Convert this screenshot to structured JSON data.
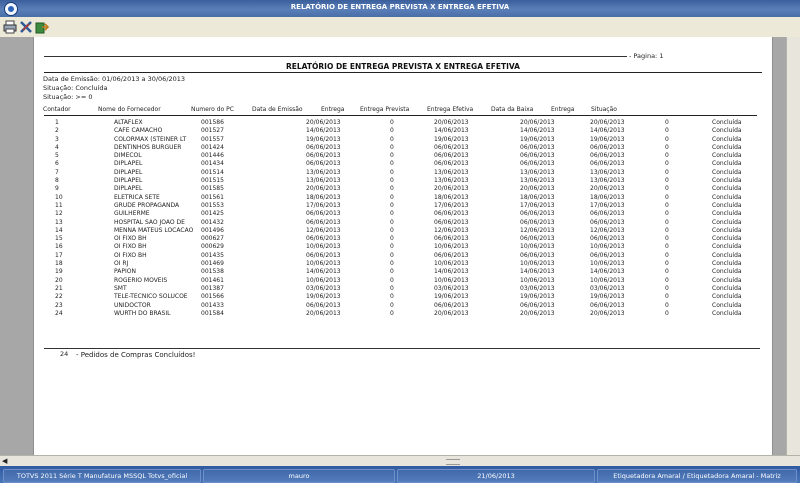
{
  "window": {
    "title": "RELATÓRIO DE ENTREGA PREVISTA X ENTREGA EFETIVA"
  },
  "toolbar": {
    "icons": [
      "print-icon",
      "close-icon",
      "export-icon"
    ]
  },
  "report": {
    "pagina": "- Pagina: 1",
    "title": "RELATÓRIO DE ENTREGA PREVISTA X ENTREGA EFETIVA",
    "emissao": "Data de Emissão: 01/06/2013 a 30/06/2013",
    "situacao": "Situação: Concluída",
    "situacao2": "Situação: >= 0",
    "columns": [
      "Contador",
      "Nome do Fornecedor",
      "Numero do PC",
      "Data de Emissão",
      "Entrega",
      "Entrega Prevista",
      "Entrega Efetiva",
      "Data da Baixa",
      "Entrega",
      "Situação"
    ],
    "rows": [
      [
        "1",
        "ALTAFLEX",
        "001586",
        "20/06/2013",
        "0",
        "20/06/2013",
        "20/06/2013",
        "20/06/2013",
        "0",
        "Concluída"
      ],
      [
        "2",
        "CAFE CAMACHO",
        "001527",
        "14/06/2013",
        "0",
        "14/06/2013",
        "14/06/2013",
        "14/06/2013",
        "0",
        "Concluída"
      ],
      [
        "3",
        "COLORMAX (STEINER LT",
        "001557",
        "19/06/2013",
        "0",
        "19/06/2013",
        "19/06/2013",
        "19/06/2013",
        "0",
        "Concluída"
      ],
      [
        "4",
        "DENTINHOS BURGUER",
        "001424",
        "06/06/2013",
        "0",
        "06/06/2013",
        "06/06/2013",
        "06/06/2013",
        "0",
        "Concluída"
      ],
      [
        "5",
        "DIMECOL",
        "001446",
        "06/06/2013",
        "0",
        "06/06/2013",
        "06/06/2013",
        "06/06/2013",
        "0",
        "Concluída"
      ],
      [
        "6",
        "DIPLAPEL",
        "001434",
        "06/06/2013",
        "0",
        "06/06/2013",
        "06/06/2013",
        "06/06/2013",
        "0",
        "Concluída"
      ],
      [
        "7",
        "DIPLAPEL",
        "001514",
        "13/06/2013",
        "0",
        "13/06/2013",
        "13/06/2013",
        "13/06/2013",
        "0",
        "Concluída"
      ],
      [
        "8",
        "DIPLAPEL",
        "001515",
        "13/06/2013",
        "0",
        "13/06/2013",
        "13/06/2013",
        "13/06/2013",
        "0",
        "Concluída"
      ],
      [
        "9",
        "DIPLAPEL",
        "001585",
        "20/06/2013",
        "0",
        "20/06/2013",
        "20/06/2013",
        "20/06/2013",
        "0",
        "Concluída"
      ],
      [
        "10",
        "ELETRICA SETE",
        "001561",
        "18/06/2013",
        "0",
        "18/06/2013",
        "18/06/2013",
        "18/06/2013",
        "0",
        "Concluída"
      ],
      [
        "11",
        "GRUDE PROPAGANDA",
        "001553",
        "17/06/2013",
        "0",
        "17/06/2013",
        "17/06/2013",
        "17/06/2013",
        "0",
        "Concluída"
      ],
      [
        "12",
        "GUILHERME",
        "001425",
        "06/06/2013",
        "0",
        "06/06/2013",
        "06/06/2013",
        "06/06/2013",
        "0",
        "Concluída"
      ],
      [
        "13",
        "HOSPITAL SAO JOAO DE",
        "001432",
        "06/06/2013",
        "0",
        "06/06/2013",
        "06/06/2013",
        "06/06/2013",
        "0",
        "Concluída"
      ],
      [
        "14",
        "MENNA MATEUS LOCACAO",
        "001496",
        "12/06/2013",
        "0",
        "12/06/2013",
        "12/06/2013",
        "12/06/2013",
        "0",
        "Concluída"
      ],
      [
        "15",
        "OI FIXO BH",
        "000627",
        "06/06/2013",
        "0",
        "06/06/2013",
        "06/06/2013",
        "06/06/2013",
        "0",
        "Concluída"
      ],
      [
        "16",
        "OI FIXO BH",
        "000629",
        "10/06/2013",
        "0",
        "10/06/2013",
        "10/06/2013",
        "10/06/2013",
        "0",
        "Concluída"
      ],
      [
        "17",
        "OI FIXO BH",
        "001435",
        "06/06/2013",
        "0",
        "06/06/2013",
        "06/06/2013",
        "06/06/2013",
        "0",
        "Concluída"
      ],
      [
        "18",
        "OI RJ",
        "001469",
        "10/06/2013",
        "0",
        "10/06/2013",
        "10/06/2013",
        "10/06/2013",
        "0",
        "Concluída"
      ],
      [
        "19",
        "PAPION",
        "001538",
        "14/06/2013",
        "0",
        "14/06/2013",
        "14/06/2013",
        "14/06/2013",
        "0",
        "Concluída"
      ],
      [
        "20",
        "ROGERIO MOVEIS",
        "001461",
        "10/06/2013",
        "0",
        "10/06/2013",
        "10/06/2013",
        "10/06/2013",
        "0",
        "Concluída"
      ],
      [
        "21",
        "SMT",
        "001387",
        "03/06/2013",
        "0",
        "03/06/2013",
        "03/06/2013",
        "03/06/2013",
        "0",
        "Concluída"
      ],
      [
        "22",
        "TELE-TECNICO SOLUCOE",
        "001566",
        "19/06/2013",
        "0",
        "19/06/2013",
        "19/06/2013",
        "19/06/2013",
        "0",
        "Concluída"
      ],
      [
        "23",
        "UNIDOCTOR",
        "001433",
        "06/06/2013",
        "0",
        "06/06/2013",
        "06/06/2013",
        "06/06/2013",
        "0",
        "Concluída"
      ],
      [
        "24",
        "WURTH DO BRASIL",
        "001584",
        "20/06/2013",
        "0",
        "20/06/2013",
        "20/06/2013",
        "20/06/2013",
        "0",
        "Concluída"
      ]
    ],
    "footer_count": "24",
    "footer_label": "- Pedidos de Compras Concluídos!"
  },
  "status": {
    "product": "TOTVS 2011 Série T Manufatura MSSQL Totvs_oficial",
    "user": "mauro",
    "date": "21/06/2013",
    "company": "Etiquetadora Amaral / Etiquetadora Amaral - Matriz"
  }
}
